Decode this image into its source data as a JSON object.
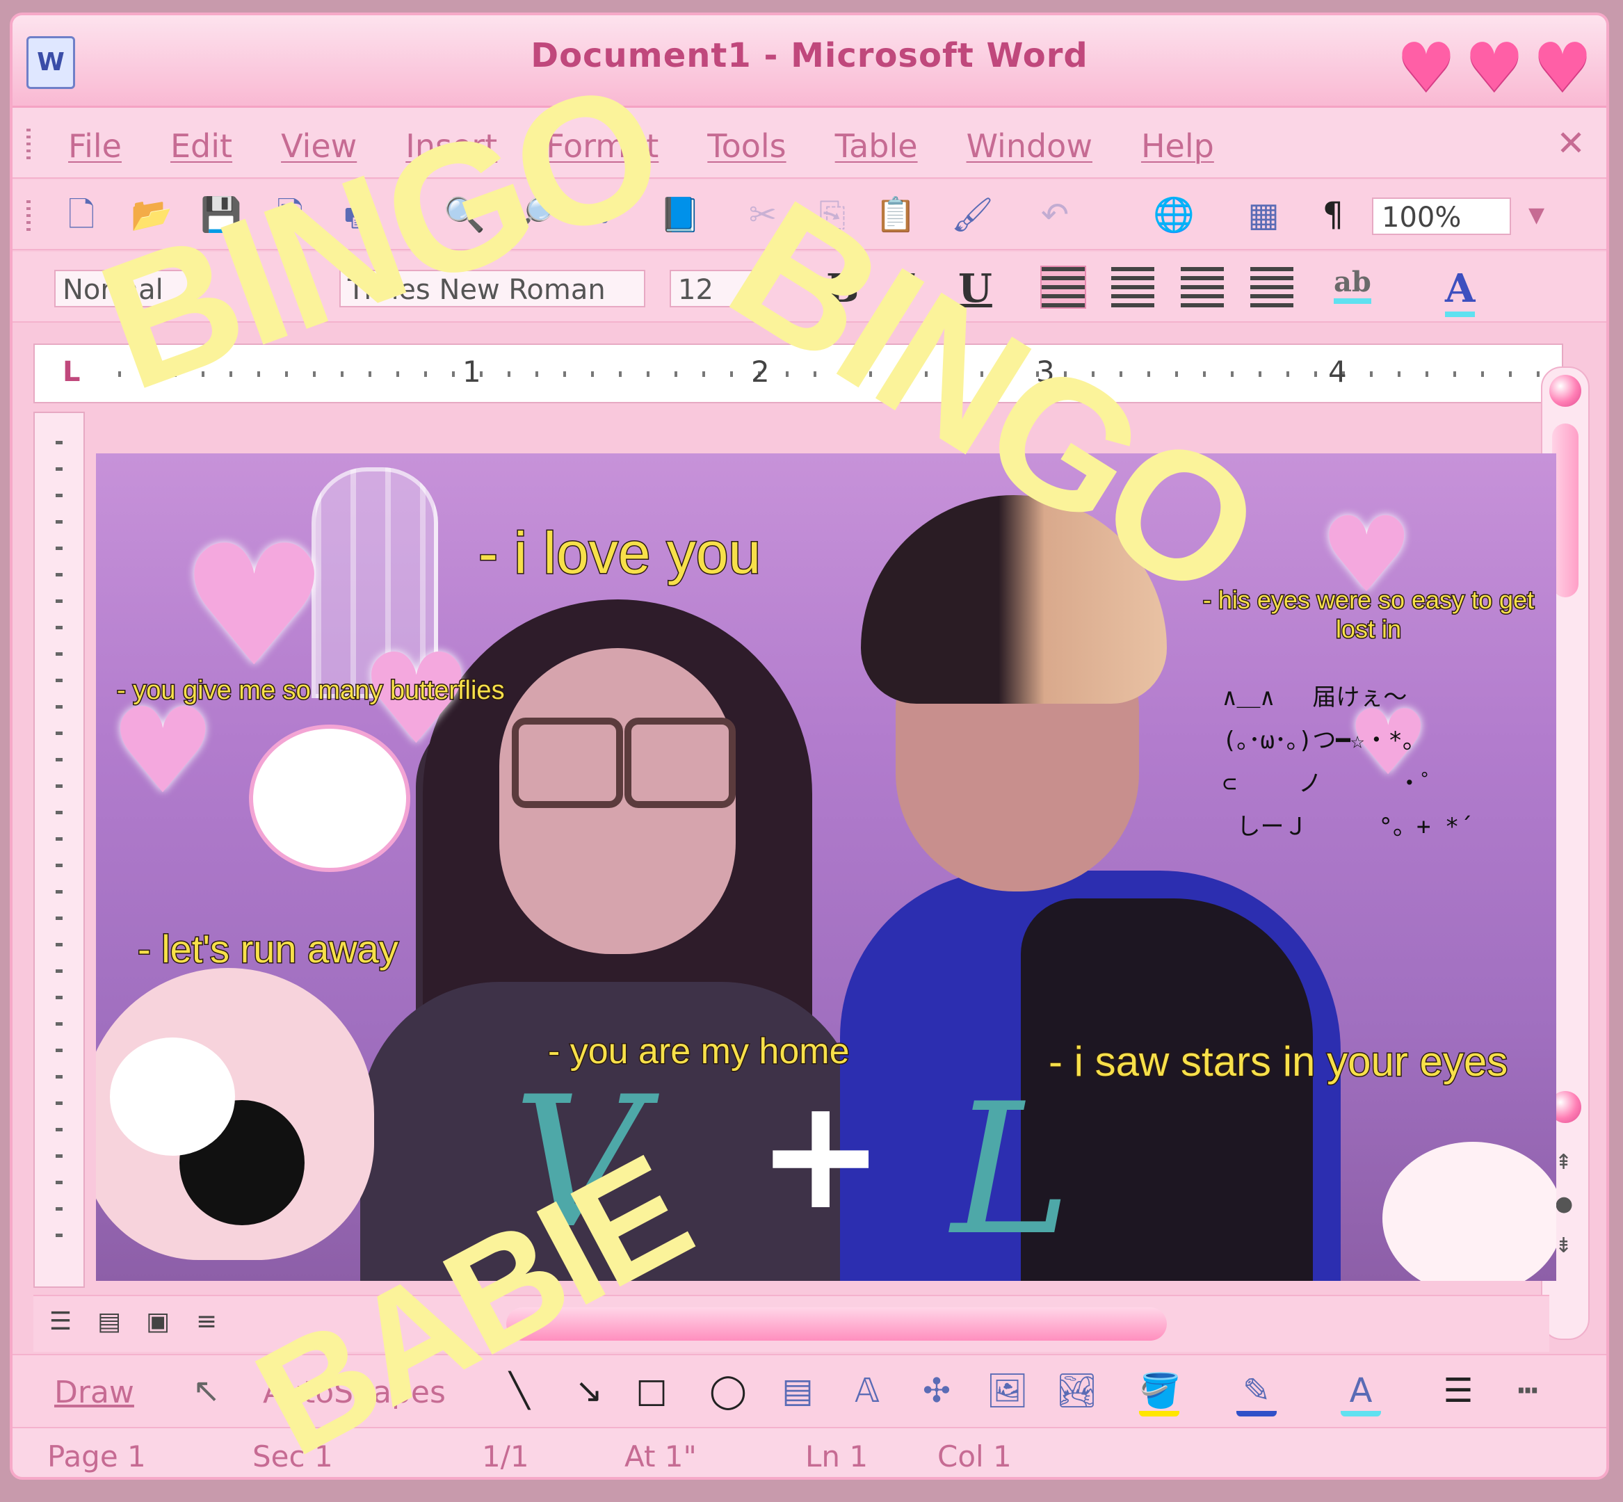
{
  "window": {
    "title": "Document1 - Microsoft Word",
    "app_icon": "W"
  },
  "menu": {
    "items": [
      "File",
      "Edit",
      "View",
      "Insert",
      "Format",
      "Tools",
      "Table",
      "Window",
      "Help"
    ],
    "close": "✕"
  },
  "toolbar": {
    "zoom": "100%",
    "style": "Normal",
    "font": "Times New Roman",
    "size": "12",
    "bold": "B",
    "italic": "I",
    "underline": "U",
    "pilcrow": "¶",
    "highlight_label": "ab",
    "font_color_label": "A"
  },
  "ruler": {
    "numbers": [
      "1",
      "2",
      "3",
      "4"
    ],
    "tab_marker": "L"
  },
  "captions": {
    "love": "- i love you",
    "butterflies": "- you give me so many butterflies",
    "eyes": "- his eyes were so easy to get lost in",
    "run": "- let's run away",
    "home": "- you are my home",
    "stars": "- i saw stars in your eyes"
  },
  "kaomoji": "∧＿∧　 届けぇ〜\n(｡･ω･｡)つ━☆・*。\n⊂　　 ノ 　　 ・゜\n しーＪ　　　°。+ *´",
  "overlay": {
    "bingo1": "BINGO",
    "bingo2": "BINGO",
    "babie": "BABIE",
    "initial_left": "V",
    "initial_right": "L",
    "plus": "+"
  },
  "drawbar": {
    "draw": "Draw",
    "autoshapes": "AutoShapes"
  },
  "status": {
    "page": "Page 1",
    "sec": "Sec 1",
    "pages": "1/1",
    "at": "At 1\"",
    "ln": "Ln 1",
    "col": "Col 1"
  },
  "colors": {
    "accent": "#f9c8dc",
    "title_text": "#c0487c",
    "caption": "#f7e04a",
    "overlay_text": "#fbf39a"
  }
}
